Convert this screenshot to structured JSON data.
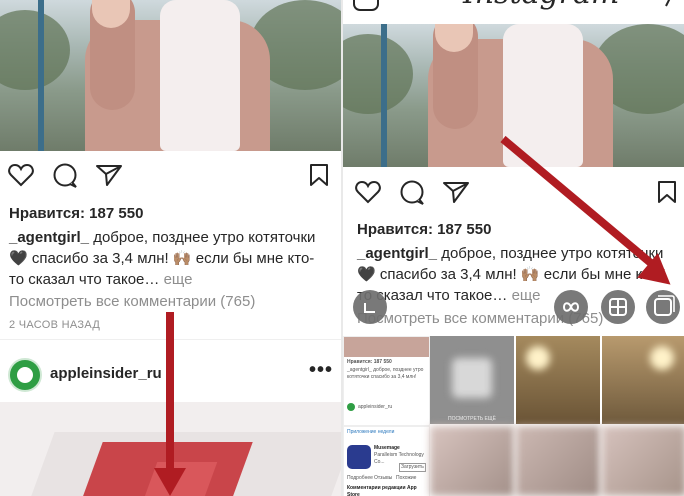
{
  "left": {
    "likes": "Нравится: 187 550",
    "caption": {
      "username": "_agentgirl_",
      "text": "доброе, позднее утро котяточки🖤 спасибо за 3,4 млн! 🙌🏽 если бы мне кто-то сказал что такое…",
      "more": "еще"
    },
    "comments_link": "Посмотреть все комментарии (765)",
    "timestamp": "2 ЧАСОВ НАЗАД",
    "next_post": {
      "username": "appleinsider_ru",
      "more_icon": "•••"
    }
  },
  "right": {
    "app_title": "Instagram",
    "likes": "Нравится: 187 550",
    "caption": {
      "username": "_agentgirl_",
      "text": "доброе, позднее утро котяточки🖤 спасибо за 3,4 млн! 🙌🏽 если бы мне кто-то сказал что такое…",
      "more": "еще"
    },
    "comments_link": "Посмотреть все комментарии (765)",
    "gallery_tiles": [
      {
        "mini_likes": "Нравится: 187 550",
        "mini_caption": "_agentgirl_ доброе, позднее утро котяточки спасибо за 3,4 млн!",
        "mini_account": "appleinsider_ru"
      },
      {
        "label": "ПОСМОТРЕТЬ ЕЩЁ"
      },
      {
        "app_section": "Приложение недели",
        "app_name": "Musemage",
        "app_dev": "Paralleism Technology Co...",
        "app_button": "Загрузить",
        "app_footer": "Комментарии редакции App Store",
        "app_tabs": [
          "Подробнее",
          "Отзывы",
          "Похожие"
        ]
      }
    ]
  },
  "colors": {
    "arrow": "#b01c22",
    "text": "#262626",
    "muted": "#8e8e8e",
    "accent_green": "#2f9e44"
  },
  "icons": [
    "heart-icon",
    "comment-icon",
    "share-icon",
    "bookmark-icon",
    "camera-icon",
    "direct-icon",
    "layout-icon",
    "boomerang-icon",
    "layout-grid-icon",
    "multi-select-icon",
    "more-icon"
  ]
}
